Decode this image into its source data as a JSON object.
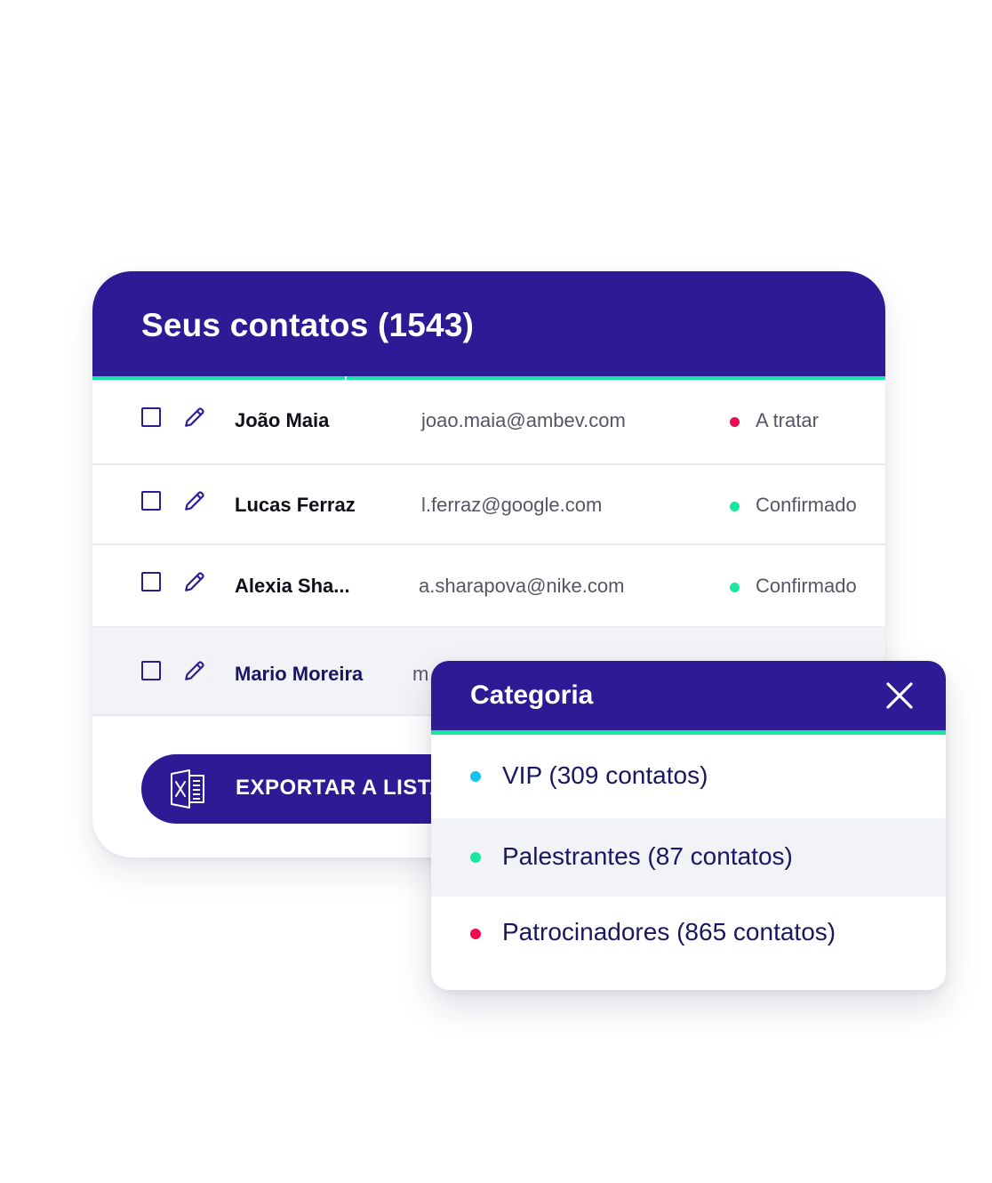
{
  "contacts_card": {
    "title": "Seus contatos (1543)",
    "rows": [
      {
        "name": "João Maia",
        "email": "joao.maia@ambev.com",
        "status": "A tratar",
        "status_color": "#ee0a50"
      },
      {
        "name": "Lucas Ferraz",
        "email": "l.ferraz@google.com",
        "status": "Confirmado",
        "status_color": "#18e7a0"
      },
      {
        "name": "Alexia Sha...",
        "email": "a.sharapova@nike.com",
        "status": "Confirmado",
        "status_color": "#18e7a0"
      },
      {
        "name": "Mario Moreira",
        "email_partial": "m"
      }
    ],
    "export_button": {
      "label": "EXPORTAR A LISTA",
      "icon": "excel-icon"
    }
  },
  "category_popup": {
    "title": "Categoria",
    "close_icon": "close-icon",
    "options": [
      {
        "label": "VIP (309 contatos)",
        "color": "#14c4f0"
      },
      {
        "label": "Palestrantes (87 contatos)",
        "color": "#18e7a0"
      },
      {
        "label": "Patrocinadores (865 contatos)",
        "color": "#ee0a50"
      }
    ]
  },
  "colors": {
    "primary": "#2d1b96",
    "accent_line": "#18e7a0",
    "row_highlight": "#f2f3f7"
  }
}
